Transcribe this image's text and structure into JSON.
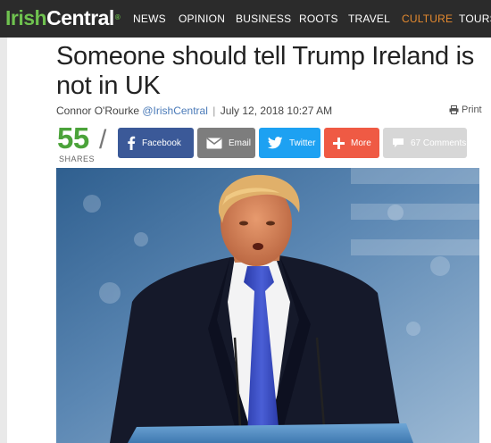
{
  "site": {
    "logo_part1": "Irish",
    "logo_part2": "Central",
    "logo_mark": "®"
  },
  "nav": {
    "items": [
      {
        "label": "NEWS"
      },
      {
        "label": "OPINION"
      },
      {
        "label": "BUSINESS"
      },
      {
        "label": "ROOTS"
      },
      {
        "label": "TRAVEL"
      },
      {
        "label": "CULTURE",
        "active": true
      },
      {
        "label": "TOURS"
      }
    ],
    "active_color": "#e58a2f"
  },
  "article": {
    "headline": "Someone should tell Trump Ireland is not in UK",
    "author": "Connor O'Rourke",
    "handle": "@IrishCentral",
    "separator": "|",
    "date": "July 12, 2018 10:27 AM",
    "print_label": "Print",
    "print_icon": "printer-icon"
  },
  "share": {
    "count": "55",
    "count_label": "SHARES",
    "slash": "/",
    "buttons": {
      "facebook": {
        "label": "Facebook",
        "icon": "facebook-icon",
        "color": "#3b5998"
      },
      "email": {
        "label": "Email",
        "icon": "envelope-icon",
        "color": "#7d7d7d"
      },
      "twitter": {
        "label": "Twitter",
        "icon": "twitter-bird-icon",
        "color": "#1da1f2"
      },
      "more": {
        "label": "More",
        "icon": "plus-icon",
        "color": "#ef5a44"
      },
      "comments": {
        "label": "67 Comments",
        "icon": "speech-bubble-icon",
        "color": "#d7d7d7"
      }
    }
  },
  "hero": {
    "description_icon": "photo"
  }
}
